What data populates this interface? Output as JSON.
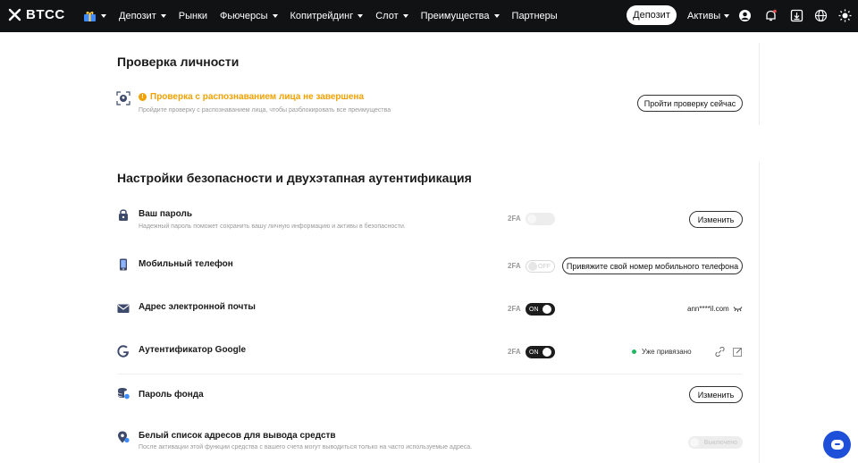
{
  "nav": {
    "logo": "BTCC",
    "items": [
      {
        "label": "Депозит",
        "dropdown": true
      },
      {
        "label": "Рынки",
        "dropdown": false
      },
      {
        "label": "Фьючерсы",
        "dropdown": true
      },
      {
        "label": "Копитрейдинг",
        "dropdown": true
      },
      {
        "label": "Слот",
        "dropdown": true
      },
      {
        "label": "Преимущества",
        "dropdown": true
      },
      {
        "label": "Партнеры",
        "dropdown": false
      }
    ],
    "deposit_button": "Депозит",
    "assets_label": "Активы",
    "icons": [
      "user-icon",
      "bell-icon",
      "download-icon",
      "globe-icon",
      "theme-sun-icon"
    ],
    "notification_dot_color": "#e5484d"
  },
  "verification": {
    "title": "Проверка личности",
    "status_title": "Проверка с распознаванием лица не завершена",
    "status_subtitle": "Пройдите проверку с распознаванием лица, чтобы разблокировать все преимущества",
    "button": "Пройти проверку сейчас",
    "status_color": "#f2a100"
  },
  "security": {
    "title": "Настройки безопасности и двухэтапная аутентификация",
    "rows": [
      {
        "label": "Ваш пароль",
        "subtitle": "Надежный пароль поможет сохранить вашу личную информацию и активы в безопасности.",
        "twofa": "2FA",
        "toggle": "disabled",
        "toggle_text": "",
        "action": "Изменить",
        "icon": "lock-icon"
      },
      {
        "label": "Мобильный телефон",
        "subtitle": "",
        "twofa": "2FA",
        "toggle": "off",
        "toggle_text": "OFF",
        "action": "Привяжите свой номер мобильного телефона",
        "icon": "phone-icon"
      },
      {
        "label": "Адрес электронной почты",
        "subtitle": "",
        "twofa": "2FA",
        "toggle": "on",
        "toggle_text": "ON",
        "value": "ann****il.com",
        "icon": "envelope-icon"
      },
      {
        "label": "Аутентификатор Google",
        "subtitle": "",
        "twofa": "2FA",
        "toggle": "on",
        "toggle_text": "ON",
        "status": "Уже привязано",
        "icon": "google-icon"
      },
      {
        "label": "Пароль фонда",
        "subtitle": "",
        "action": "Изменить",
        "icon": "database-icon"
      },
      {
        "label": "Белый список адресов для вывода средств",
        "subtitle": "После активации этой функции средства с вашего счета могут выводиться только на часто используемые адреса.",
        "toggle_text": "Выключено",
        "icon": "location-pin-icon"
      }
    ],
    "bound_color": "#22b562"
  },
  "support": {
    "icon": "chat-icon",
    "color": "#1e4fd8"
  }
}
